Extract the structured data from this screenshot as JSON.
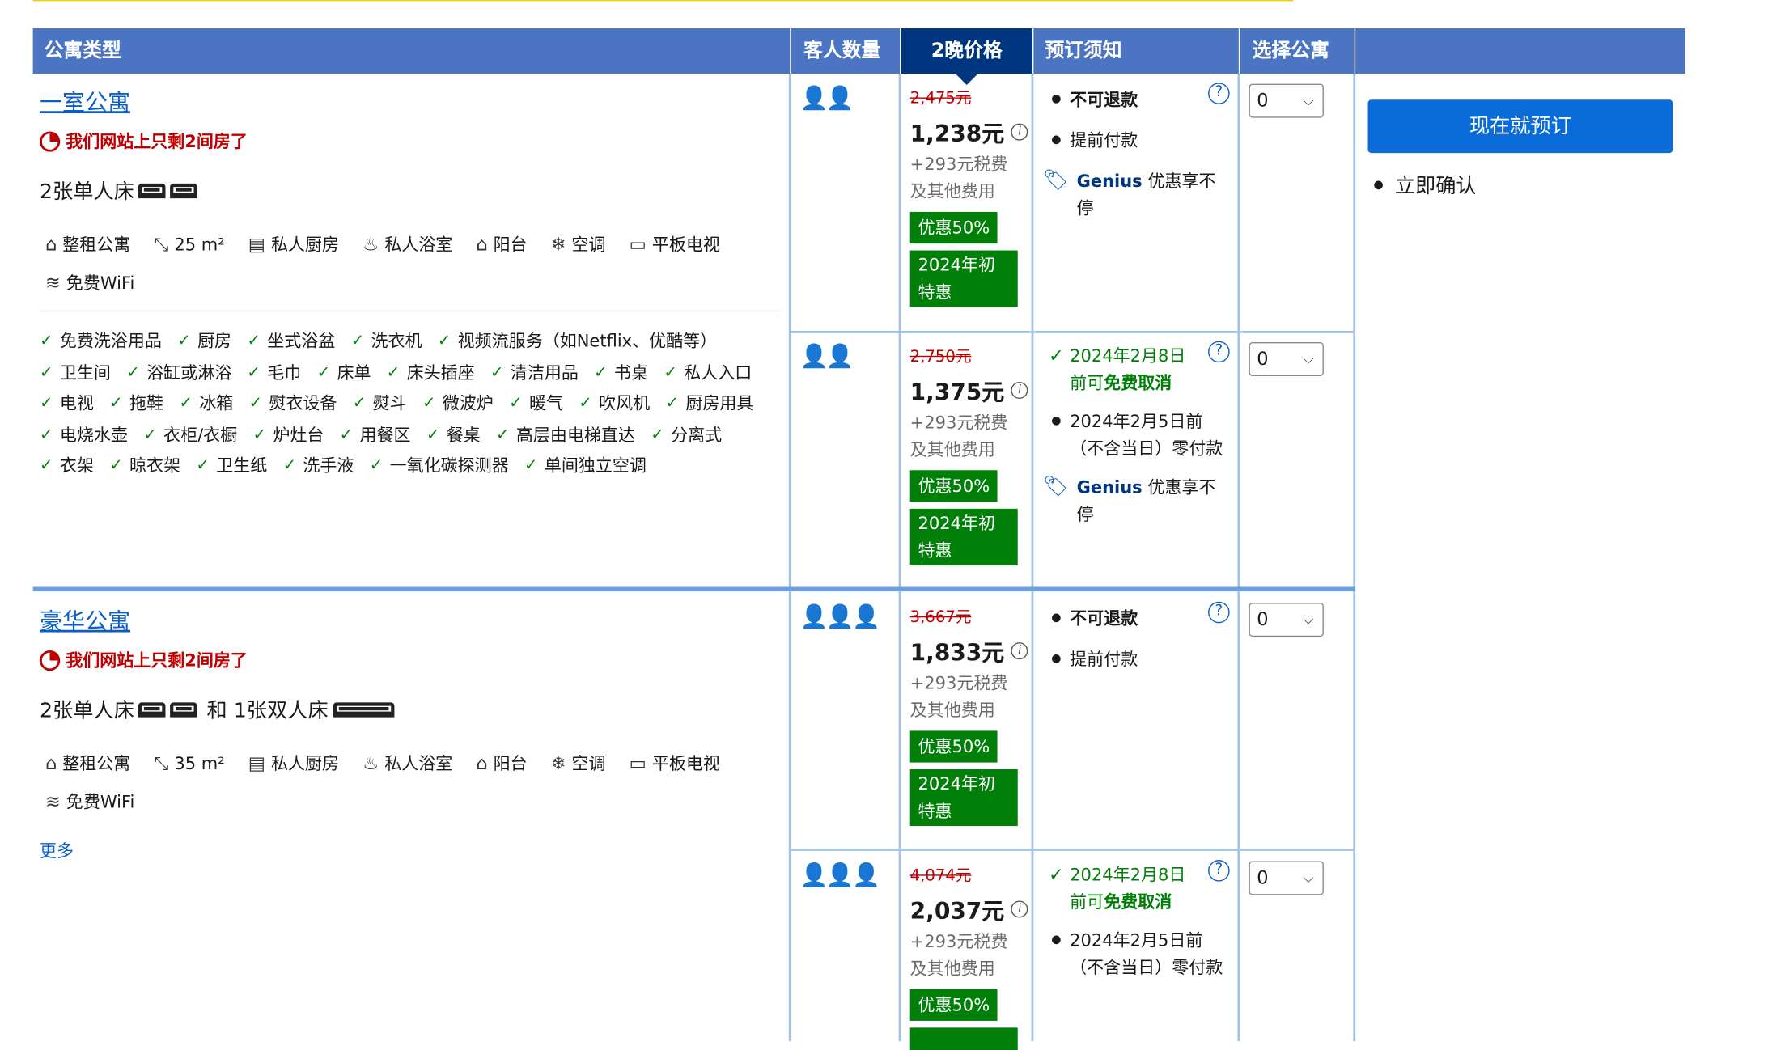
{
  "headers": {
    "type": "公寓类型",
    "guests": "客人数量",
    "price": "2晚价格",
    "policy": "预订须知",
    "select": "选择公寓"
  },
  "apartments": [
    {
      "name": "一室公寓",
      "scarcity": "我们网站上只剩2间房了",
      "beds": "2张单人床",
      "beds_extra": "",
      "beds_double": "",
      "facilities": [
        "整租公寓",
        "25 m²",
        "私人厨房",
        "私人浴室",
        "阳台",
        "空调",
        "平板电视",
        "免费WiFi"
      ],
      "amenities": [
        "免费洗浴用品",
        "厨房",
        "坐式浴盆",
        "洗衣机",
        "视频流服务（如Netflix、优酷等）",
        "卫生间",
        "浴缸或淋浴",
        "毛巾",
        "床单",
        "床头插座",
        "清洁用品",
        "书桌",
        "私人入口",
        "电视",
        "拖鞋",
        "冰箱",
        "熨衣设备",
        "熨斗",
        "微波炉",
        "暖气",
        "吹风机",
        "厨房用具",
        "电烧水壶",
        "衣柜/衣橱",
        "炉灶台",
        "用餐区",
        "餐桌",
        "高层由电梯直达",
        "分离式",
        "衣架",
        "晾衣架",
        "卫生纸",
        "洗手液",
        "一氧化碳探测器",
        "单间独立空调"
      ],
      "more": "",
      "options": [
        {
          "original": "2,475元",
          "price": "1,238元",
          "tax": "+293元税费及其他费用",
          "discount": "优惠50%",
          "deal": "2024年初特惠",
          "policy_a": "不可退款",
          "policy_b": "提前付款",
          "genius": "Genius",
          "genius_text": "优惠享不停",
          "qty": "0"
        },
        {
          "original": "2,750元",
          "price": "1,375元",
          "tax": "+293元税费及其他费用",
          "discount": "优惠50%",
          "deal": "2024年初特惠",
          "cancel_date": "2024年2月8日",
          "cancel_pre": "前可",
          "cancel_free": "免费取消",
          "pay_later": "2024年2月5日前（不含当日）零付款",
          "genius": "Genius",
          "genius_text": "优惠享不停",
          "qty": "0"
        }
      ]
    },
    {
      "name": "豪华公寓",
      "scarcity": "我们网站上只剩2间房了",
      "beds": "2张单人床",
      "beds_extra": "和 1张双人床",
      "facilities": [
        "整租公寓",
        "35 m²",
        "私人厨房",
        "私人浴室",
        "阳台",
        "空调",
        "平板电视",
        "免费WiFi"
      ],
      "more": "更多",
      "options": [
        {
          "original": "3,667元",
          "price": "1,833元",
          "tax": "+293元税费及其他费用",
          "discount": "优惠50%",
          "deal": "2024年初特惠",
          "policy_a": "不可退款",
          "policy_b": "提前付款",
          "qty": "0"
        },
        {
          "original": "4,074元",
          "price": "2,037元",
          "tax": "+293元税费及其他费用",
          "discount": "优惠50%",
          "cancel_date": "2024年2月8日",
          "cancel_pre": "前可",
          "cancel_free": "免费取消",
          "pay_later": "2024年2月5日前（不含当日）零付款",
          "qty": "0"
        }
      ]
    }
  ],
  "book_button": "现在就预订",
  "confirm": "立即确认",
  "colors": {
    "header": "#4b74c3",
    "header_dark": "#003580",
    "book": "#0a6cd8",
    "deal": "#008009",
    "strike": "#c00000"
  },
  "icons": {
    "guest": "person-icon",
    "scarcity": "clock-icon",
    "info": "info-icon",
    "question": "question-icon",
    "tag": "tag-icon",
    "check": "check-icon",
    "select": "chevron-down-icon"
  }
}
